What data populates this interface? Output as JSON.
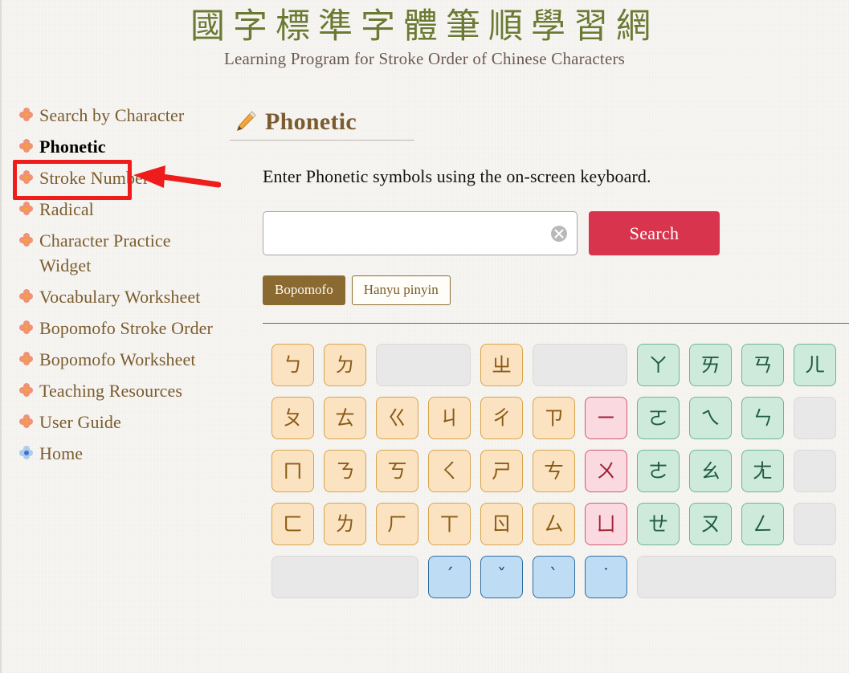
{
  "header": {
    "title_cn": "國字標準字體筆順學習網",
    "subtitle": "Learning Program for Stroke Order of Chinese Characters"
  },
  "sidebar": {
    "items": [
      {
        "label": "Search by Character",
        "flower": "orange-flower-icon",
        "highlighted": false
      },
      {
        "label": "Phonetic",
        "flower": "orange-flower-icon",
        "highlighted": true
      },
      {
        "label": "Stroke Number",
        "flower": "orange-flower-icon",
        "highlighted": false
      },
      {
        "label": "Radical",
        "flower": "orange-flower-icon",
        "highlighted": false
      },
      {
        "label": "Character Practice Widget",
        "flower": "orange-flower-icon",
        "highlighted": false
      },
      {
        "label": "Vocabulary Worksheet",
        "flower": "orange-flower-icon",
        "highlighted": false
      },
      {
        "label": "Bopomofo Stroke Order",
        "flower": "orange-flower-icon",
        "highlighted": false
      },
      {
        "label": "Bopomofo Worksheet",
        "flower": "orange-flower-icon",
        "highlighted": false
      },
      {
        "label": "Teaching Resources",
        "flower": "orange-flower-icon",
        "highlighted": false
      },
      {
        "label": "User Guide",
        "flower": "orange-flower-icon",
        "highlighted": false
      },
      {
        "label": "Home",
        "flower": "blue-flower-icon",
        "highlighted": false
      }
    ]
  },
  "annotation": {
    "target": "Phonetic",
    "box_color": "#ef1c1c",
    "arrow_color": "#ef1c1c"
  },
  "main": {
    "section_icon": "pencil-icon",
    "section_title": "Phonetic",
    "instruction": "Enter Phonetic symbols using the on-screen keyboard.",
    "search": {
      "value": "",
      "placeholder": "",
      "clear_icon": "clear-circle-x-icon",
      "button_label": "Search",
      "button_color": "#d8344e"
    },
    "tabs": [
      {
        "label": "Bopomofo",
        "active": true
      },
      {
        "label": "Hanyu pinyin",
        "active": false
      }
    ]
  },
  "keyboard": {
    "legend": {
      "consonant_color": "#fbe3c2",
      "medial_color": "#fad9e0",
      "vowel_color": "#cdeadb",
      "tone_color": "#bfdcf5",
      "blank_color": "#e8e8e8"
    },
    "rows": [
      [
        {
          "label": "ㄅ",
          "type": "consonant",
          "span": 1
        },
        {
          "label": "ㄉ",
          "type": "consonant",
          "span": 1
        },
        {
          "label": "",
          "type": "blank",
          "span": 2
        },
        {
          "label": "ㄓ",
          "type": "consonant",
          "span": 1
        },
        {
          "label": "",
          "type": "blank",
          "span": 2
        },
        {
          "label": "ㄚ",
          "type": "vowel",
          "span": 1
        },
        {
          "label": "ㄞ",
          "type": "vowel",
          "span": 1
        },
        {
          "label": "ㄢ",
          "type": "vowel",
          "span": 1
        },
        {
          "label": "ㄦ",
          "type": "vowel",
          "span": 1
        }
      ],
      [
        {
          "label": "ㄆ",
          "type": "consonant",
          "span": 1
        },
        {
          "label": "ㄊ",
          "type": "consonant",
          "span": 1
        },
        {
          "label": "ㄍ",
          "type": "consonant",
          "span": 1
        },
        {
          "label": "ㄐ",
          "type": "consonant",
          "span": 1
        },
        {
          "label": "ㄔ",
          "type": "consonant",
          "span": 1
        },
        {
          "label": "ㄗ",
          "type": "consonant",
          "span": 1
        },
        {
          "label": "ㄧ",
          "type": "medial",
          "span": 1
        },
        {
          "label": "ㄛ",
          "type": "vowel",
          "span": 1
        },
        {
          "label": "ㄟ",
          "type": "vowel",
          "span": 1
        },
        {
          "label": "ㄣ",
          "type": "vowel",
          "span": 1
        },
        {
          "label": "",
          "type": "blank",
          "span": 1
        }
      ],
      [
        {
          "label": "ㄇ",
          "type": "consonant",
          "span": 1
        },
        {
          "label": "ㄋ",
          "type": "consonant",
          "span": 1
        },
        {
          "label": "ㄎ",
          "type": "consonant",
          "span": 1
        },
        {
          "label": "ㄑ",
          "type": "consonant",
          "span": 1
        },
        {
          "label": "ㄕ",
          "type": "consonant",
          "span": 1
        },
        {
          "label": "ㄘ",
          "type": "consonant",
          "span": 1
        },
        {
          "label": "ㄨ",
          "type": "medial",
          "span": 1
        },
        {
          "label": "ㄜ",
          "type": "vowel",
          "span": 1
        },
        {
          "label": "ㄠ",
          "type": "vowel",
          "span": 1
        },
        {
          "label": "ㄤ",
          "type": "vowel",
          "span": 1
        },
        {
          "label": "",
          "type": "blank",
          "span": 1
        }
      ],
      [
        {
          "label": "ㄈ",
          "type": "consonant",
          "span": 1
        },
        {
          "label": "ㄌ",
          "type": "consonant",
          "span": 1
        },
        {
          "label": "ㄏ",
          "type": "consonant",
          "span": 1
        },
        {
          "label": "ㄒ",
          "type": "consonant",
          "span": 1
        },
        {
          "label": "ㄖ",
          "type": "consonant",
          "span": 1
        },
        {
          "label": "ㄙ",
          "type": "consonant",
          "span": 1
        },
        {
          "label": "ㄩ",
          "type": "medial",
          "span": 1
        },
        {
          "label": "ㄝ",
          "type": "vowel",
          "span": 1
        },
        {
          "label": "ㄡ",
          "type": "vowel",
          "span": 1
        },
        {
          "label": "ㄥ",
          "type": "vowel",
          "span": 1
        },
        {
          "label": "",
          "type": "blank",
          "span": 1
        }
      ],
      [
        {
          "label": "",
          "type": "blank",
          "span": 3
        },
        {
          "label": "ˊ",
          "type": "tone",
          "span": 1
        },
        {
          "label": "ˇ",
          "type": "tone",
          "span": 1
        },
        {
          "label": "ˋ",
          "type": "tone",
          "span": 1
        },
        {
          "label": "˙",
          "type": "tone",
          "span": 1
        },
        {
          "label": "",
          "type": "blank",
          "span": 4
        }
      ]
    ]
  }
}
